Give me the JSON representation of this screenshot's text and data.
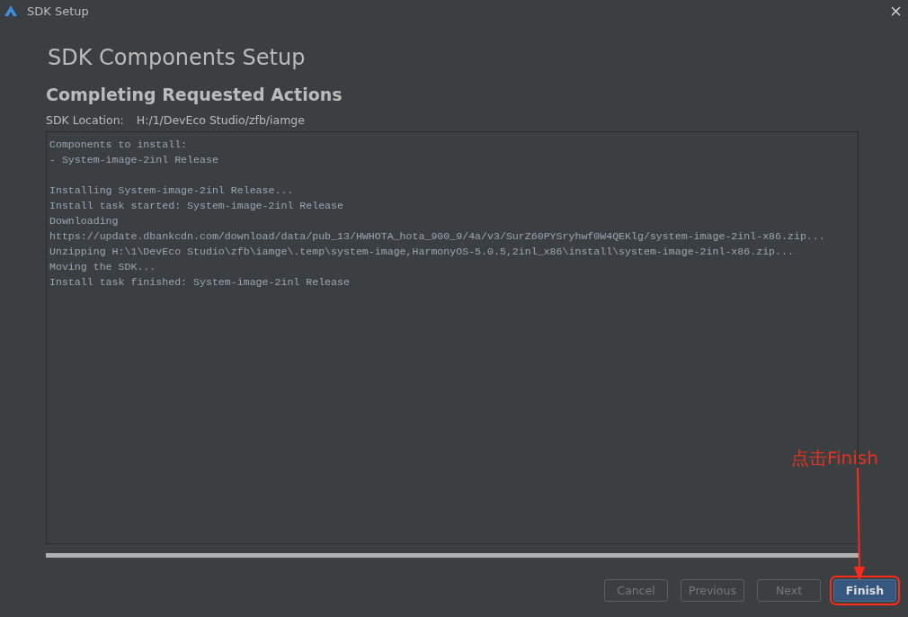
{
  "window": {
    "title": "SDK Setup"
  },
  "heading": "SDK Components Setup",
  "subheading": "Completing Requested Actions",
  "location": {
    "label": "SDK Location:",
    "value": "H:/1/DevEco Studio/zfb/iamge"
  },
  "log": [
    {
      "lines": [
        "Components to install:",
        "- System-image-2inl Release"
      ]
    },
    {
      "lines": [
        "Installing System-image-2inl Release...",
        "Install task started: System-image-2inl Release",
        "Downloading",
        "https://update.dbankcdn.com/download/data/pub_13/HWHOTA_hota_900_9/4a/v3/SurZ60PYSryhwf0W4QEKlg/system-image-2inl-x86.zip...",
        "Unzipping H:\\1\\DevEco Studio\\zfb\\iamge\\.temp\\system-image,HarmonyOS-5.0.5,2inl_x86\\install\\system-image-2inl-x86.zip...",
        "Moving the SDK...",
        "Install task finished: System-image-2inl Release"
      ]
    }
  ],
  "progress": {
    "level": 1
  },
  "buttons": [
    {
      "label": "Cancel",
      "kind": "secondary",
      "disabled": true,
      "highlighted": false
    },
    {
      "label": "Previous",
      "kind": "secondary",
      "disabled": true,
      "highlighted": false
    },
    {
      "label": "Next",
      "kind": "secondary",
      "disabled": true,
      "highlighted": false
    },
    {
      "label": "Finish",
      "kind": "primary",
      "disabled": false,
      "highlighted": true
    }
  ],
  "annotation": {
    "label": "点击Finish"
  }
}
